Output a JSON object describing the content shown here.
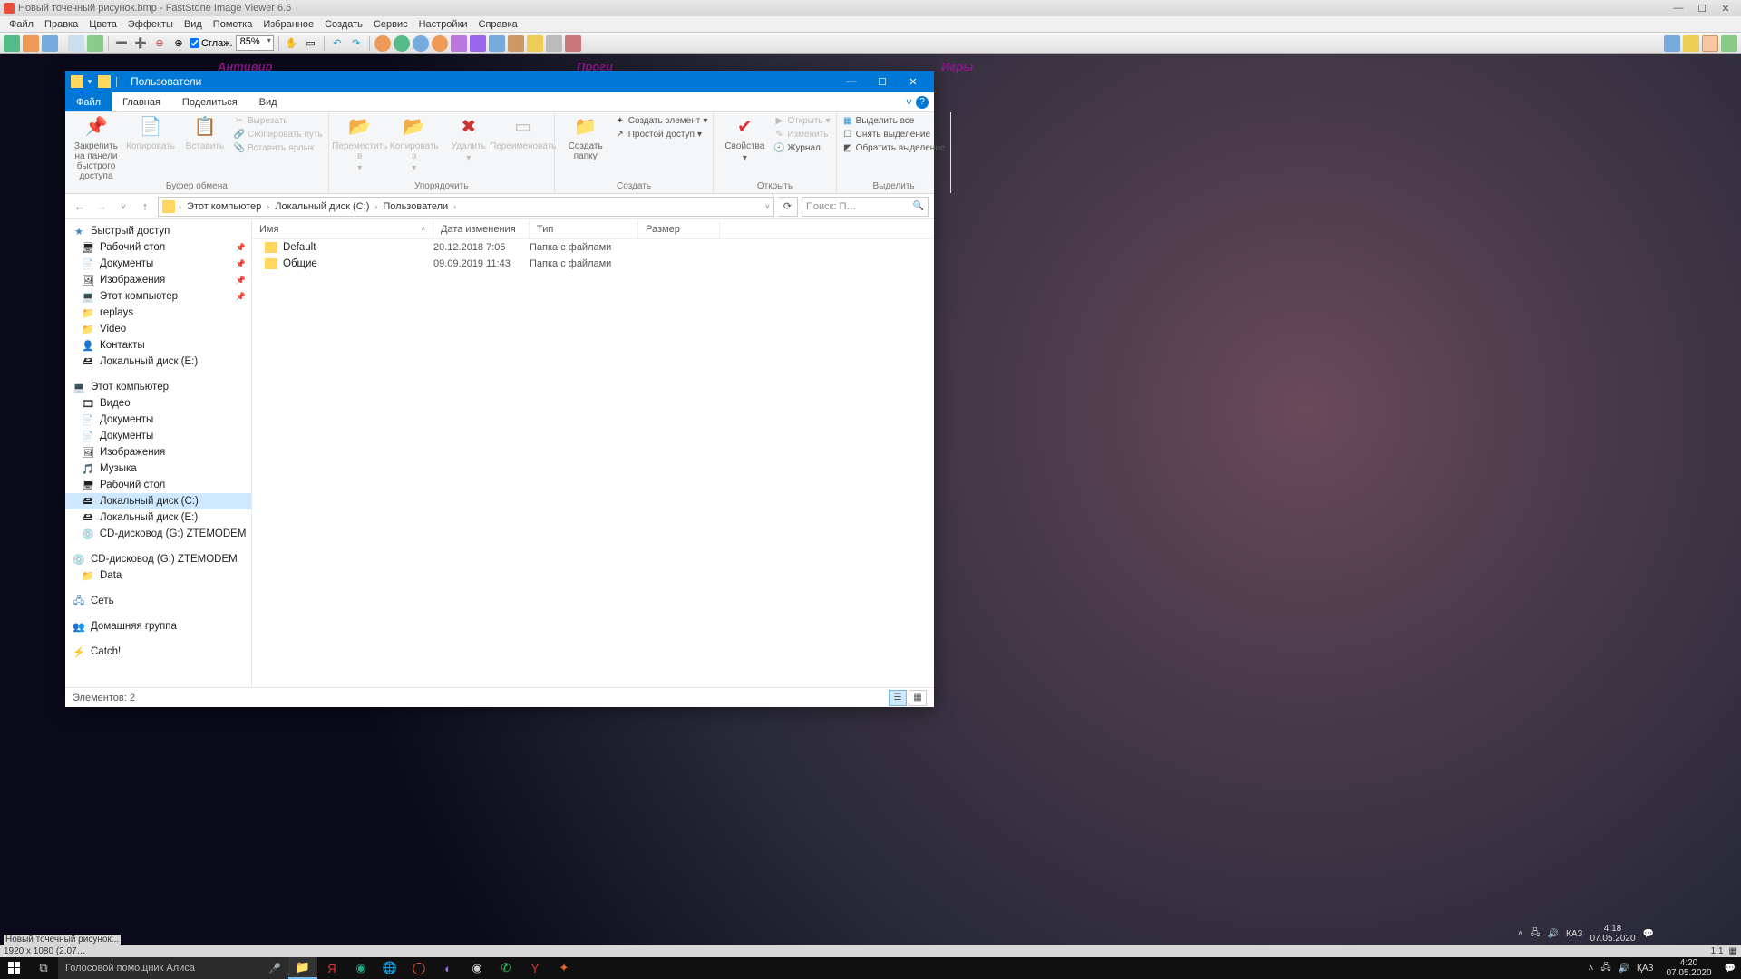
{
  "faststone": {
    "title": "Новый точечный рисунок.bmp  -  FastStone Image Viewer 6.6",
    "menu": [
      "Файл",
      "Правка",
      "Цвета",
      "Эффекты",
      "Вид",
      "Пометка",
      "Избранное",
      "Создать",
      "Сервис",
      "Настройки",
      "Справка"
    ],
    "smooth_label": "Сглаж.",
    "zoom": "85%",
    "status_left": "1920 x 1080 (2.07…",
    "status_file": "Новый точечный рисунок...",
    "status_ratio": "1:1",
    "desk_labels": {
      "l1": "Антивир",
      "l2": "Проги",
      "l3": "Игры"
    }
  },
  "explorer": {
    "title": "Пользователи",
    "tabs": {
      "file": "Файл",
      "home": "Главная",
      "share": "Поделиться",
      "view": "Вид"
    },
    "ribbon": {
      "pin": "Закрепить на панели быстрого доступа",
      "copy": "Копировать",
      "paste": "Вставить",
      "cut": "Вырезать",
      "copy_path": "Скопировать путь",
      "paste_shortcut": "Вставить ярлык",
      "clipboard": "Буфер обмена",
      "move_to": "Переместить в",
      "copy_to": "Копировать в",
      "delete": "Удалить",
      "rename": "Переименовать",
      "organize": "Упорядочить",
      "new_folder": "Создать папку",
      "new_item": "Создать элемент",
      "easy_access": "Простой доступ",
      "create": "Создать",
      "properties": "Свойства",
      "open": "Открыть",
      "open_small": "Открыть",
      "edit": "Изменить",
      "history": "Журнал",
      "select_all": "Выделить все",
      "select_none": "Снять выделение",
      "invert": "Обратить выделение",
      "select": "Выделить"
    },
    "crumbs": [
      "Этот компьютер",
      "Локальный диск (C:)",
      "Пользователи"
    ],
    "search_placeholder": "Поиск: П…",
    "nav": {
      "quick": "Быстрый доступ",
      "quick_items": [
        {
          "label": "Рабочий стол",
          "pin": true,
          "icon": "🖥"
        },
        {
          "label": "Документы",
          "pin": true,
          "icon": "📄"
        },
        {
          "label": "Изображения",
          "pin": true,
          "icon": "🖼"
        },
        {
          "label": "Этот компьютер",
          "pin": true,
          "icon": "💻"
        },
        {
          "label": "replays",
          "pin": false,
          "icon": "📁"
        },
        {
          "label": "Video",
          "pin": false,
          "icon": "📁"
        },
        {
          "label": "Контакты",
          "pin": false,
          "icon": "👤"
        },
        {
          "label": "Локальный диск (E:)",
          "pin": false,
          "icon": "🖴"
        }
      ],
      "thispc": "Этот компьютер",
      "thispc_items": [
        {
          "label": "Видео",
          "icon": "🎞"
        },
        {
          "label": "Документы",
          "icon": "📄"
        },
        {
          "label": "Документы",
          "icon": "📄"
        },
        {
          "label": "Изображения",
          "icon": "🖼"
        },
        {
          "label": "Музыка",
          "icon": "🎵"
        },
        {
          "label": "Рабочий стол",
          "icon": "🖥"
        },
        {
          "label": "Локальный диск (C:)",
          "icon": "🖴",
          "selected": true
        },
        {
          "label": "Локальный диск (E:)",
          "icon": "🖴"
        },
        {
          "label": "CD-дисковод (G:) ZTEMODEM",
          "icon": "💿"
        }
      ],
      "cd": "CD-дисковод (G:) ZTEMODEM",
      "data": "Data",
      "network": "Сеть",
      "homegroup": "Домашняя группа",
      "catch": "Catch!"
    },
    "columns": {
      "name": "Имя",
      "date": "Дата изменения",
      "type": "Тип",
      "size": "Размер"
    },
    "rows": [
      {
        "name": "Default",
        "date": "20.12.2018 7:05",
        "type": "Папка с файлами"
      },
      {
        "name": "Общие",
        "date": "09.09.2019 11:43",
        "type": "Папка с файлами"
      }
    ],
    "status": "Элементов: 2"
  },
  "tray_inner": {
    "lang": "ҚАЗ",
    "time": "4:18",
    "date": "07.05.2020"
  },
  "taskbar": {
    "alisa": "Голосовой помощник Алиса",
    "lang": "ҚАЗ",
    "time": "4:20",
    "date": "07.05.2020"
  }
}
